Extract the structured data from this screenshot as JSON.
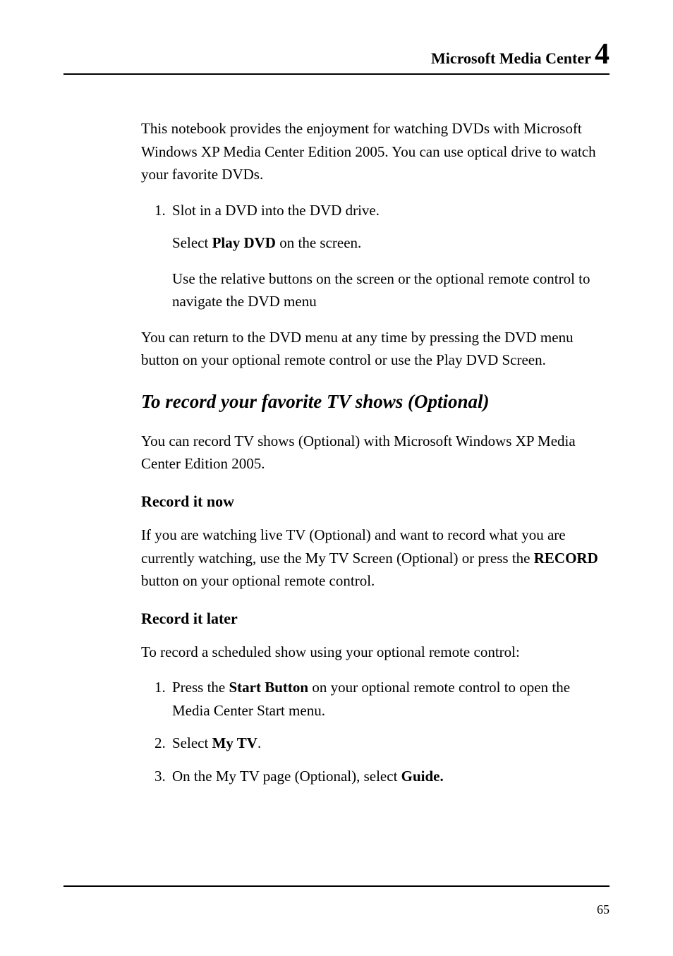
{
  "header": {
    "title": "Microsoft Media Center",
    "chapter_number": "4"
  },
  "body": {
    "intro": "This notebook provides the enjoyment for watching DVDs with Microsoft Windows XP Media Center Edition 2005. You can use optical drive to watch your favorite DVDs.",
    "dvd_steps": {
      "step1_a": "Slot in a DVD into the DVD drive.",
      "step1_b_pre": "Select ",
      "step1_b_bold": "Play DVD",
      "step1_b_post": " on the screen.",
      "step1_c": "Use the relative buttons on the screen or the optional remote control to navigate the DVD menu"
    },
    "dvd_note": "You can return to the DVD menu at any time by pressing the DVD menu button on your optional remote control or use the Play DVD Screen.",
    "section_record_heading": "To record your favorite TV shows (Optional)",
    "record_intro": "You can record TV shows (Optional) with Microsoft Windows XP Media Center Edition 2005.",
    "record_now_heading": "Record it now",
    "record_now_para_pre": "If you are watching live TV (Optional) and want to record what you are currently watching, use the My TV Screen (Optional) or press the ",
    "record_now_para_bold": "RECORD",
    "record_now_para_post": " button on your optional remote control.",
    "record_later_heading": "Record it later",
    "record_later_intro": "To record a scheduled show using your optional remote control:",
    "record_later_steps": {
      "s1_pre": "Press the ",
      "s1_bold": "Start Button",
      "s1_post": " on your optional remote control to open the Media Center Start menu.",
      "s2_pre": "Select ",
      "s2_bold": "My TV",
      "s2_post": ".",
      "s3_pre": "On the My TV page (Optional), select ",
      "s3_bold": "Guide.",
      "s3_post": ""
    }
  },
  "footer": {
    "page_number": "65"
  }
}
